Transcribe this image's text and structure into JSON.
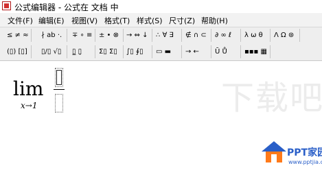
{
  "window": {
    "title": "公式编辑器 - 公式在 文档 中"
  },
  "menu": [
    {
      "label": "文件(F)"
    },
    {
      "label": "编辑(E)"
    },
    {
      "label": "视图(V)"
    },
    {
      "label": "格式(T)"
    },
    {
      "label": "样式(S)"
    },
    {
      "label": "尺寸(Z)"
    },
    {
      "label": "帮助(H)"
    }
  ],
  "toolbar": {
    "row1": [
      {
        "label": "≤ ≠ ≈"
      },
      {
        "label": "∤ ab ·."
      },
      {
        "label": "∓ ∘ ≡"
      },
      {
        "label": "± • ⊗"
      },
      {
        "label": "→ ⇔ ↓"
      },
      {
        "label": "∴ ∀ ∃"
      },
      {
        "label": "∉ ∩ ⊂"
      },
      {
        "label": "∂ ∞ ℓ"
      },
      {
        "label": "λ ω θ"
      },
      {
        "label": "Λ Ω ⊛"
      }
    ],
    "row2": [
      {
        "label": "(▯) [▯]"
      },
      {
        "label": "▯/▯ √▯"
      },
      {
        "label": "▯̲ ▯̣"
      },
      {
        "label": "Σ▯ Σ▯"
      },
      {
        "label": "∫▯ ∮▯"
      },
      {
        "label": "▭ ▬"
      },
      {
        "label": "→ ←"
      },
      {
        "label": "Ū Ů"
      },
      {
        "label": "▪▪▪ ▦"
      }
    ]
  },
  "equation": {
    "operator": "lim",
    "subscript": "x→1"
  },
  "watermark": "下载吧",
  "logo": {
    "name": "PPT家园",
    "url": "www.pptjia.com"
  },
  "colors": {
    "menu_bg": "#f2f2f2",
    "toolbar_bg": "#eeeeee",
    "logo_blue": "#2a5fc8"
  }
}
